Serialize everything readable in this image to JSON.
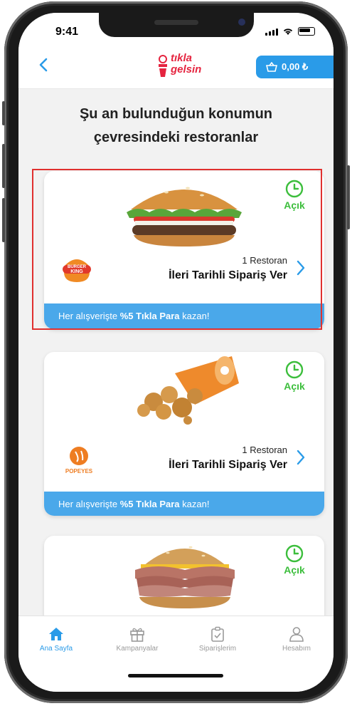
{
  "status_bar": {
    "time": "9:41"
  },
  "header": {
    "logo_line1": "tıkla",
    "logo_line2": "gelsin",
    "wallet_amount": "0,00 ₺"
  },
  "page_title_line1": "Şu an bulunduğun konumun",
  "page_title_line2": "çevresindeki restoranlar",
  "cards": [
    {
      "brand_line1": "BURGER",
      "brand_line2": "KING",
      "status": "Açık",
      "restaurant_count": "1 Restoran",
      "order_label": "İleri Tarihli Sipariş Ver",
      "promo_prefix": "Her alışverişte ",
      "promo_bold": "%5 Tıkla Para",
      "promo_suffix": " kazan!"
    },
    {
      "brand_line1": "POPEYES",
      "status": "Açık",
      "restaurant_count": "1 Restoran",
      "order_label": "İleri Tarihli Sipariş Ver",
      "promo_prefix": "Her alışverişte ",
      "promo_bold": "%5 Tıkla Para",
      "promo_suffix": " kazan!"
    },
    {
      "status": "Açık"
    }
  ],
  "tabs": [
    {
      "label": "Ana Sayfa",
      "icon": "home-icon"
    },
    {
      "label": "Kampanyalar",
      "icon": "gift-icon"
    },
    {
      "label": "Siparişlerim",
      "icon": "orders-icon"
    },
    {
      "label": "Hesabım",
      "icon": "user-icon"
    }
  ],
  "colors": {
    "accent_blue": "#2a9be8",
    "promo_blue": "#4aa8ea",
    "open_green": "#3cbe3c",
    "brand_red": "#e5243f",
    "highlight_red": "#e0302f"
  }
}
